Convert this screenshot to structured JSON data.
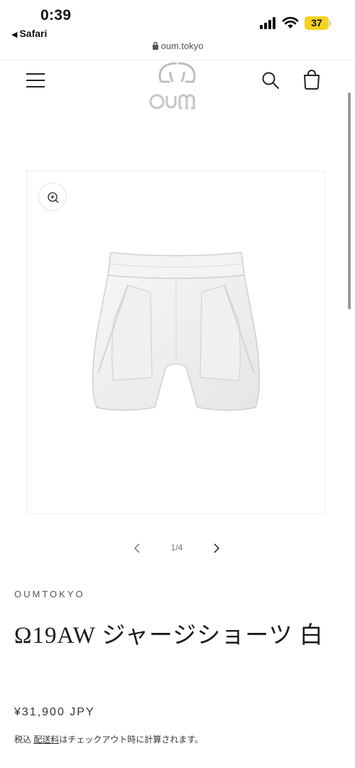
{
  "status_bar": {
    "time": "0:39",
    "back_app": "Safari",
    "battery": "37"
  },
  "browser": {
    "url": "oum.tokyo"
  },
  "header": {
    "logo_text": "oum"
  },
  "media": {
    "counter": "1/4"
  },
  "product": {
    "vendor": "OUMTOKYO",
    "title": "Ω19AW ジャージショーツ 白",
    "price": "¥31,900 JPY",
    "tax_prefix": "税込",
    "shipping_link": "配送料",
    "tax_suffix": "はチェックアウト時に計算されます。"
  },
  "colors": {
    "battery": "#f5d21f",
    "text": "#121212",
    "muted": "#777777"
  }
}
